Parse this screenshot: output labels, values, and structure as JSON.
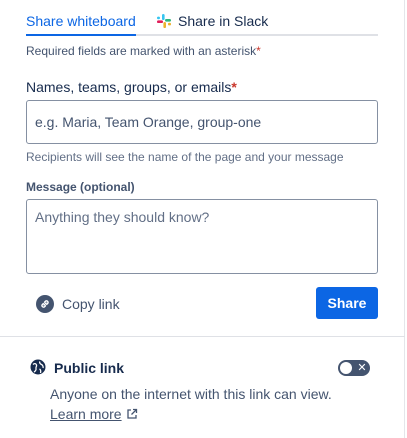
{
  "tabs": [
    {
      "label": "Share whiteboard",
      "active": true
    },
    {
      "label": "Share in Slack",
      "active": false
    }
  ],
  "form": {
    "required_note": "Required fields are marked with an asterisk",
    "asterisk": "*",
    "names_label": "Names, teams, groups, or emails",
    "names_placeholder": "e.g. Maria, Team Orange, group-one",
    "names_value": "",
    "recipients_note": "Recipients will see the name of the page and your message",
    "message_label": "Message (optional)",
    "message_placeholder": "Anything they should know?",
    "message_value": ""
  },
  "actions": {
    "copy_link_label": "Copy link",
    "share_label": "Share"
  },
  "public_link": {
    "title": "Public link",
    "description": "Anyone on the internet with this link can view.",
    "learn_more": "Learn more",
    "enabled": false
  },
  "colors": {
    "accent": "#0c66e4",
    "required": "#c9372c",
    "text": "#172b4d",
    "subtle_text": "#44546f"
  },
  "icons": {
    "slack": "slack-icon",
    "copy_link": "link-icon",
    "public": "globe-icon",
    "external": "external-link-icon",
    "toggle_off": "close-icon"
  }
}
